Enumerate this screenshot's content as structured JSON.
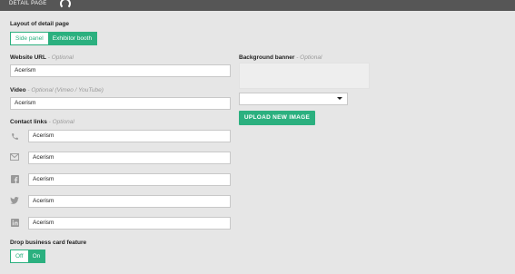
{
  "header": {
    "title": "DETAIL PAGE"
  },
  "layout": {
    "label": "Layout of detail page",
    "options": [
      "Side panel",
      "Exhibitor booth"
    ],
    "selected": "Exhibitor booth"
  },
  "website": {
    "label": "Website URL",
    "optional": " - Optional",
    "value": "Acerism"
  },
  "video": {
    "label": "Video",
    "optional": " - Optional (Vimeo / YouTube)",
    "value": "Acerism"
  },
  "contacts": {
    "label": "Contact links",
    "optional": " - Optional",
    "items": [
      {
        "icon": "phone-icon",
        "value": "Acerism"
      },
      {
        "icon": "email-icon",
        "value": "Acerism"
      },
      {
        "icon": "facebook-icon",
        "value": "Acerism"
      },
      {
        "icon": "twitter-icon",
        "value": "Acerism"
      },
      {
        "icon": "linkedin-icon",
        "value": "Acerism"
      }
    ]
  },
  "banner": {
    "label": "Background banner",
    "optional": " - Optional",
    "select_value": "",
    "upload_label": "UPLOAD NEW IMAGE"
  },
  "business_card": {
    "label": "Drop business card feature",
    "options": [
      "Off",
      "On"
    ],
    "selected": "On"
  },
  "colors": {
    "accent": "#2bb07f",
    "topbar": "#565656",
    "background": "#e6e6e6"
  }
}
